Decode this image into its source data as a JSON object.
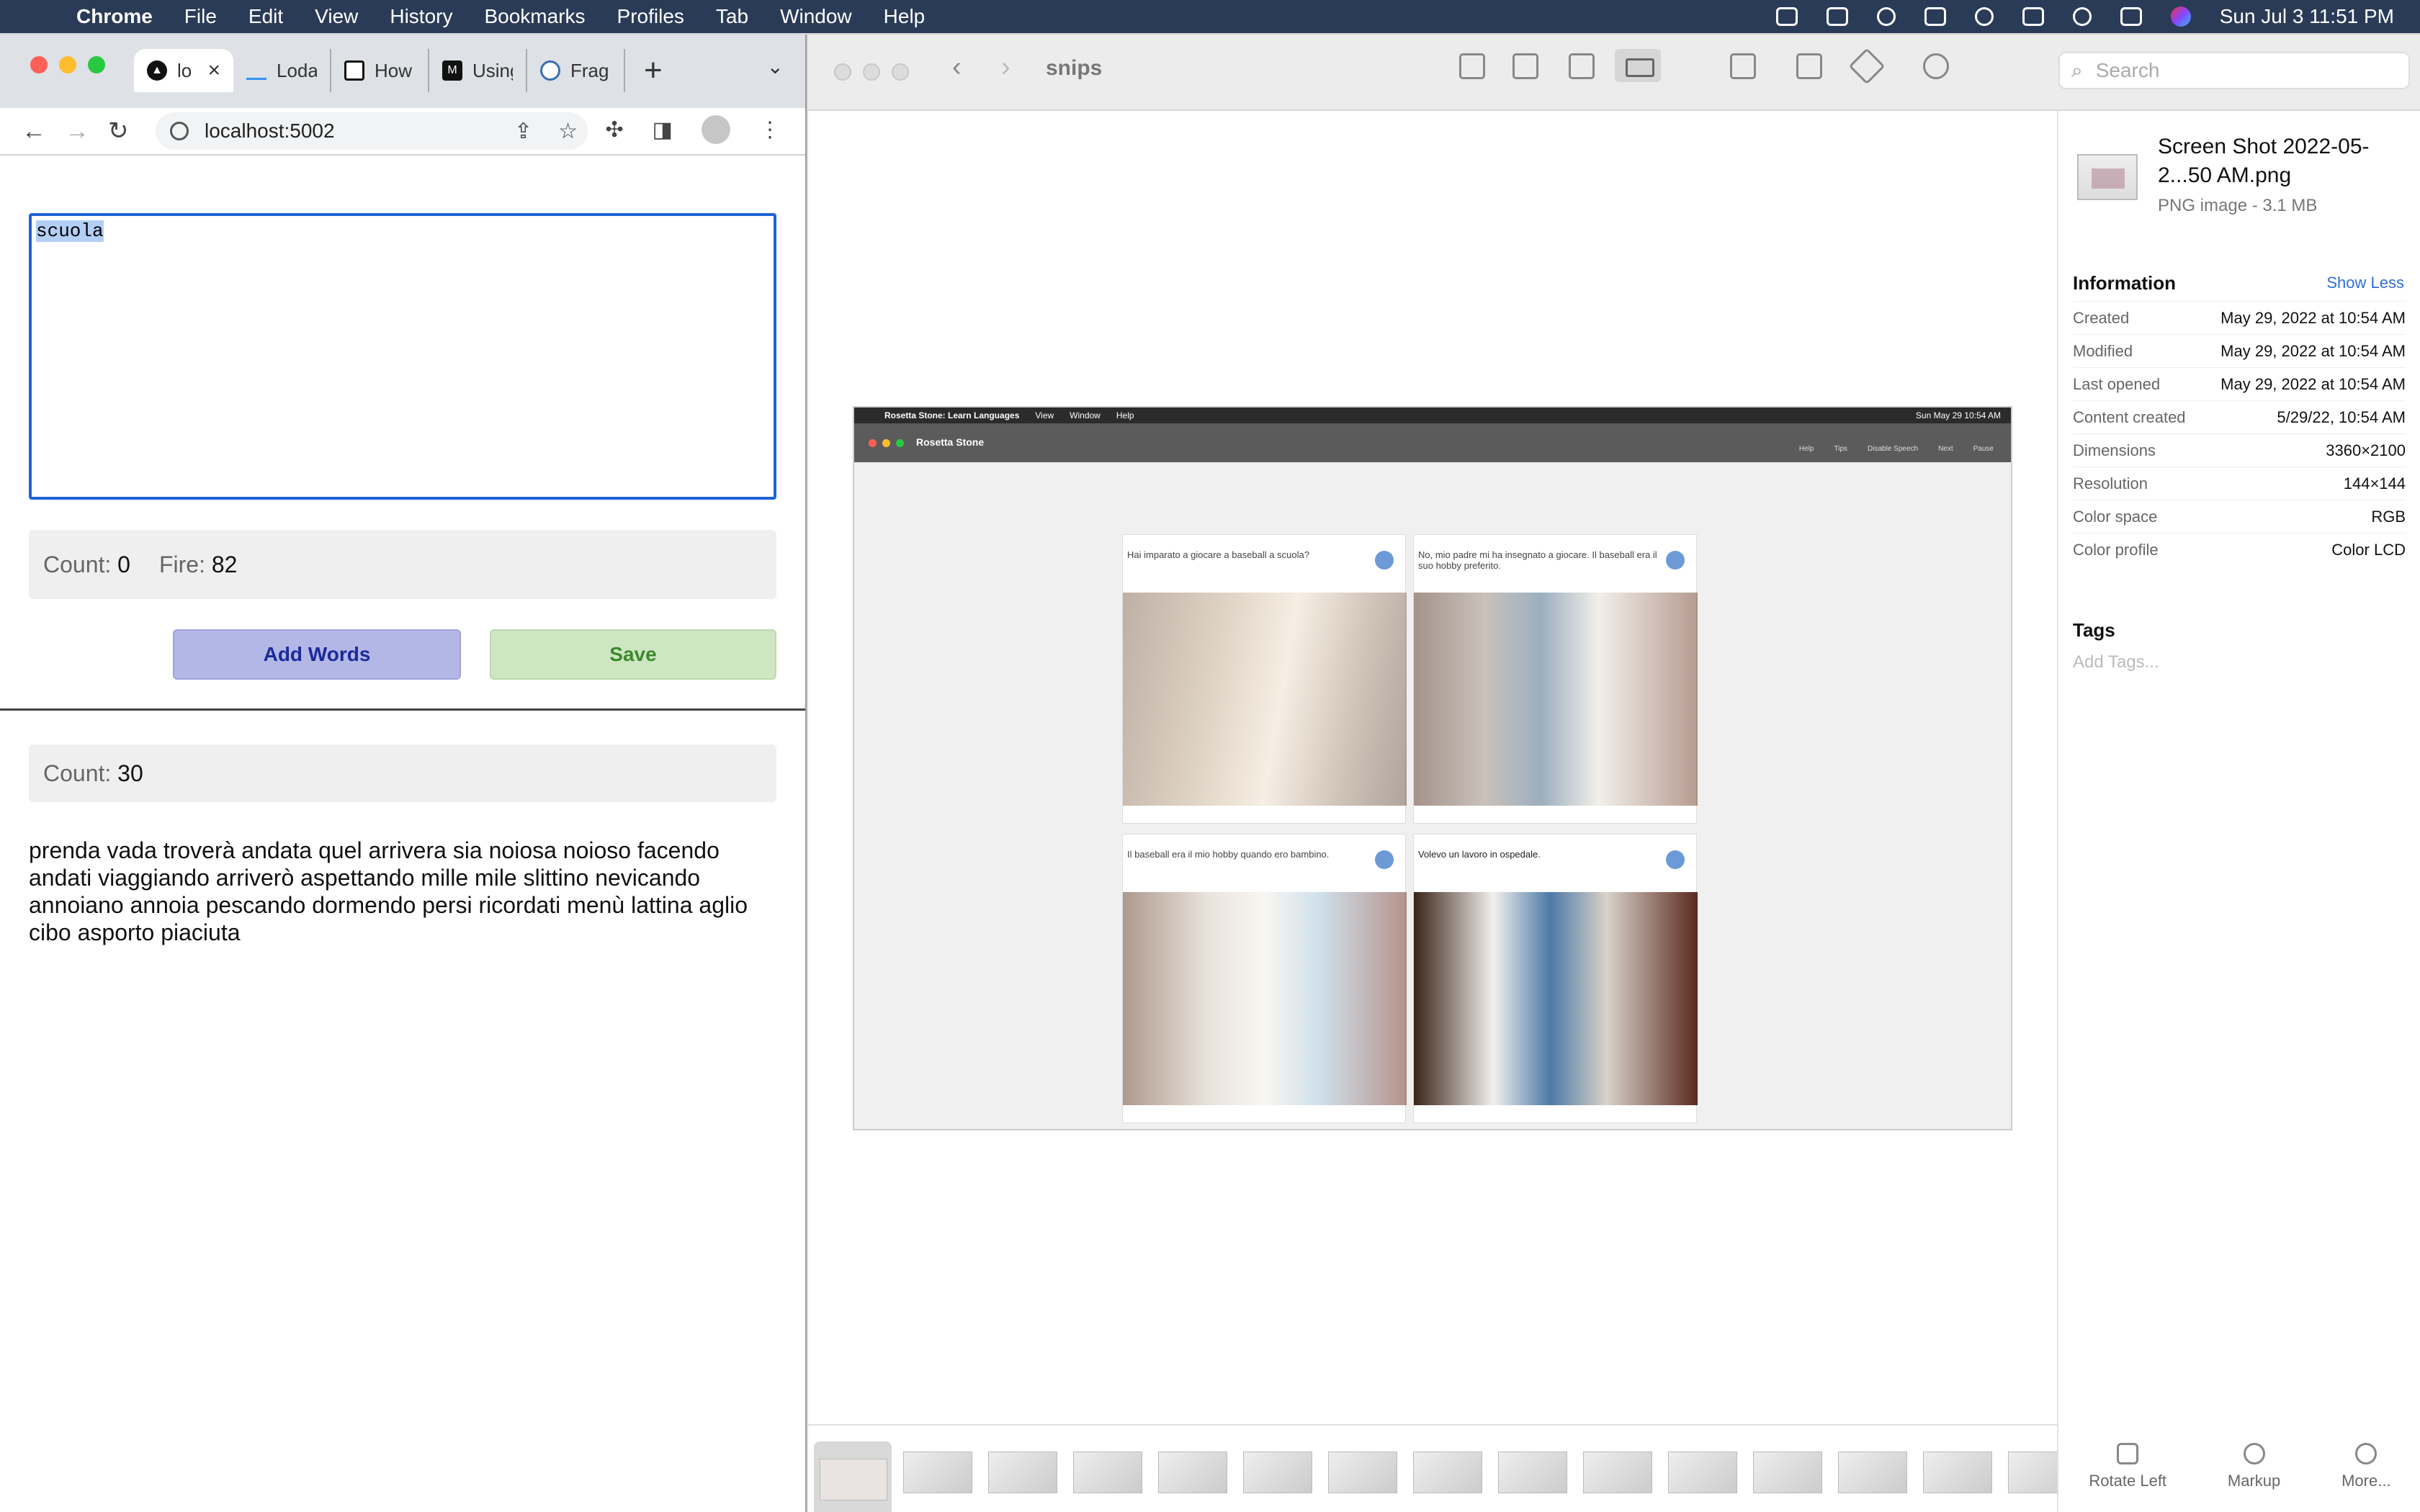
{
  "menubar": {
    "app": "Chrome",
    "items": [
      "File",
      "Edit",
      "View",
      "History",
      "Bookmarks",
      "Profiles",
      "Tab",
      "Window",
      "Help"
    ],
    "clock": "Sun Jul 3  11:51 PM"
  },
  "chrome": {
    "tabs": [
      {
        "label": "lo",
        "icon": "triangle-icon"
      },
      {
        "label": "Loda",
        "icon": "lodash-icon"
      },
      {
        "label": "How",
        "icon": "cube-icon"
      },
      {
        "label": "Using",
        "icon": "m-logo-icon"
      },
      {
        "label": "Frag",
        "icon": "react-icon"
      }
    ],
    "url": "localhost:5002",
    "input_value": "scuola",
    "count_label": "Count:",
    "count_value": "0",
    "fire_label": "Fire:",
    "fire_value": "82",
    "add_words_label": "Add Words",
    "save_label": "Save",
    "count2_label": "Count:",
    "count2_value": "30",
    "word_list": "prenda vada troverà andata quel arrivera sia noiosa noioso facendo andati viaggiando arriverò aspettando mille mile slittino nevicando annoiano annoia pescando dormendo persi ricordati menù lattina aglio cibo asporto piaciuta"
  },
  "finder": {
    "folder_title": "snips",
    "search_placeholder": "Search",
    "preview": {
      "menubar_app": "Rosetta Stone: Learn Languages",
      "menubar_items": [
        "View",
        "Window",
        "Help"
      ],
      "menubar_clock": "Sun May 29  10:54 AM",
      "window_title": "Rosetta Stone",
      "actions": [
        "Help",
        "Tips",
        "Disable Speech",
        "Next",
        "Pause"
      ],
      "cards": [
        {
          "caption": "Hai imparato a giocare a baseball a scuola?"
        },
        {
          "caption": "No, mio padre mi ha insegnato a giocare. Il baseball era il suo hobby preferito."
        },
        {
          "caption": "Il baseball era il mio hobby quando ero bambino."
        },
        {
          "caption": "Volevo un lavoro in ospedale."
        }
      ]
    },
    "sidebar": {
      "file_name": "Screen Shot 2022-05-2...50 AM.png",
      "file_kind": "PNG image - 3.1 MB",
      "info_heading": "Information",
      "show_less": "Show Less",
      "rows": [
        {
          "label": "Created",
          "value": "May 29, 2022 at 10:54 AM"
        },
        {
          "label": "Modified",
          "value": "May 29, 2022 at 10:54 AM"
        },
        {
          "label": "Last opened",
          "value": "May 29, 2022 at 10:54 AM"
        },
        {
          "label": "Content created",
          "value": "5/29/22, 10:54 AM"
        },
        {
          "label": "Dimensions",
          "value": "3360×2100"
        },
        {
          "label": "Resolution",
          "value": "144×144"
        },
        {
          "label": "Color space",
          "value": "RGB"
        },
        {
          "label": "Color profile",
          "value": "Color LCD"
        }
      ],
      "tags_heading": "Tags",
      "tags_placeholder": "Add Tags...",
      "actions": [
        "Rotate Left",
        "Markup",
        "More..."
      ]
    }
  }
}
